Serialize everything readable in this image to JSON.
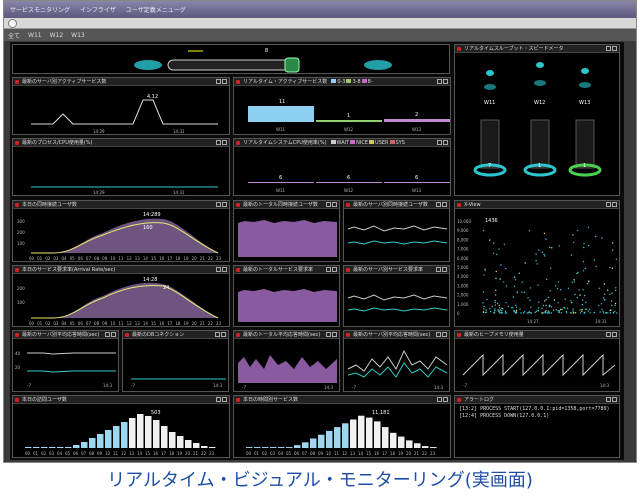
{
  "header": {
    "items": [
      "サービスモニタリング",
      "インフライザ",
      "ユーザ定義メニューグ"
    ]
  },
  "tabs": [
    "全て",
    "W11",
    "W12",
    "W13"
  ],
  "top_flow": {
    "count": "8"
  },
  "panels": {
    "active_service": {
      "title": "最新のサーバ別アクティブサービス数",
      "peak": "4.12",
      "x_ticks": [
        "14:29",
        "14:31"
      ]
    },
    "realtime_active": {
      "title": "リアルタイム・アクティブサービス数",
      "legend": [
        "0-3",
        "3-8",
        "8-"
      ],
      "values": [
        "11",
        "1",
        "2"
      ],
      "servers": [
        "W11",
        "W12",
        "W13"
      ]
    },
    "process_cpu": {
      "title": "最新のプロセス/CPU使用量(%)",
      "x_ticks": [
        "14:29",
        "14:31"
      ]
    },
    "realtime_cpu": {
      "title": "リアルタイムシステムCPU使用率(%)",
      "legend": [
        "WAIT",
        "NICE",
        "USER",
        "SYS"
      ],
      "values": [
        "6",
        "6",
        "6"
      ],
      "servers": [
        "W11",
        "W12",
        "W13"
      ]
    },
    "today_users": {
      "title": "本日の同時接続ユーザ数",
      "y_ticks": [
        "300",
        "200",
        "100"
      ],
      "annotations": [
        "14:289",
        "160"
      ],
      "x_ticks": [
        "00",
        "01",
        "02",
        "03",
        "04",
        "05",
        "06",
        "07",
        "08",
        "09",
        "10",
        "11",
        "12",
        "13",
        "14",
        "15",
        "16",
        "17",
        "18",
        "19",
        "20",
        "21",
        "22",
        "23"
      ]
    },
    "total_users": {
      "title": "最新のトータル同時接続ユーザ数"
    },
    "server_users": {
      "title": "最新のサーバ別同時接続ユーザ数"
    },
    "xlog": {
      "title": "X-View",
      "y_ticks": [
        "10,000",
        "9,000",
        "8,000",
        "7,000",
        "6,000",
        "5,000",
        "4,000",
        "3,000",
        "2,000",
        "1,000",
        "0"
      ],
      "annotation": "1436",
      "x_ticks": [
        "14:27",
        "14:31"
      ]
    },
    "today_requests": {
      "title": "本日のサービス要求率(Arrival Rate/sec)",
      "y_ticks": [
        "200",
        "100"
      ],
      "annotations": [
        "14:28",
        "24"
      ],
      "x_ticks": [
        "00",
        "01",
        "02",
        "03",
        "04",
        "05",
        "06",
        "07",
        "08",
        "09",
        "10",
        "11",
        "12",
        "13",
        "14",
        "15",
        "16",
        "17",
        "18",
        "19",
        "20",
        "21",
        "22",
        "23"
      ]
    },
    "total_requests": {
      "title": "最新のトータルサービス要求率"
    },
    "server_requests": {
      "title": "最新のサーバ別サービス要求率"
    },
    "server_response": {
      "title": "最新のサーバ別平均応答時間(sec)",
      "y_ticks": [
        "40",
        "20"
      ],
      "x_ticks": [
        "-7",
        "14:3"
      ]
    },
    "db_connections": {
      "title": "最新のDBコネクション",
      "x_ticks": [
        "-7",
        "14:3"
      ]
    },
    "total_response": {
      "title": "最新のトータル平均応答時間(sec)",
      "x_ticks": [
        "-7",
        "14:3"
      ]
    },
    "server_response2": {
      "title": "最新のサーバ別平均応答時間(sec)",
      "x_ticks": [
        "-7",
        "14:3"
      ]
    },
    "heap": {
      "title": "最新のヒープメモリ使用量",
      "x_ticks": [
        "-7",
        "14:3"
      ]
    },
    "today_visitors": {
      "title": "本日の訪問ユーザ数",
      "peak": "503",
      "x_ticks": [
        "00",
        "01",
        "02",
        "03",
        "04",
        "05",
        "06",
        "07",
        "08",
        "09",
        "10",
        "11",
        "12",
        "13",
        "14",
        "15",
        "16",
        "17",
        "18",
        "19",
        "20",
        "21",
        "22",
        "23"
      ]
    },
    "today_service_count": {
      "title": "本日の時間別サービス数",
      "peak": "11,181",
      "x_ticks": [
        "00",
        "01",
        "02",
        "03",
        "04",
        "05",
        "06",
        "07",
        "08",
        "09",
        "10",
        "11",
        "12",
        "13",
        "14",
        "15",
        "16",
        "17",
        "18",
        "19",
        "20",
        "21",
        "22",
        "23"
      ]
    },
    "speedometer": {
      "title": "リアルタイムスループット・スピードメータ",
      "servers": [
        "W11",
        "W12",
        "W13"
      ],
      "values": [
        "7",
        "1",
        "1"
      ]
    },
    "alert_log": {
      "title": "アラートログ",
      "lines": [
        "[13:2] PROCESS START(127.0.0.1:pid=1358,port=7780)",
        "[12:4] PROCESS DOWN(127.0.0.1)"
      ]
    }
  },
  "caption": "リアルタイム・ビジュアル・モニターリング(実画面)"
}
